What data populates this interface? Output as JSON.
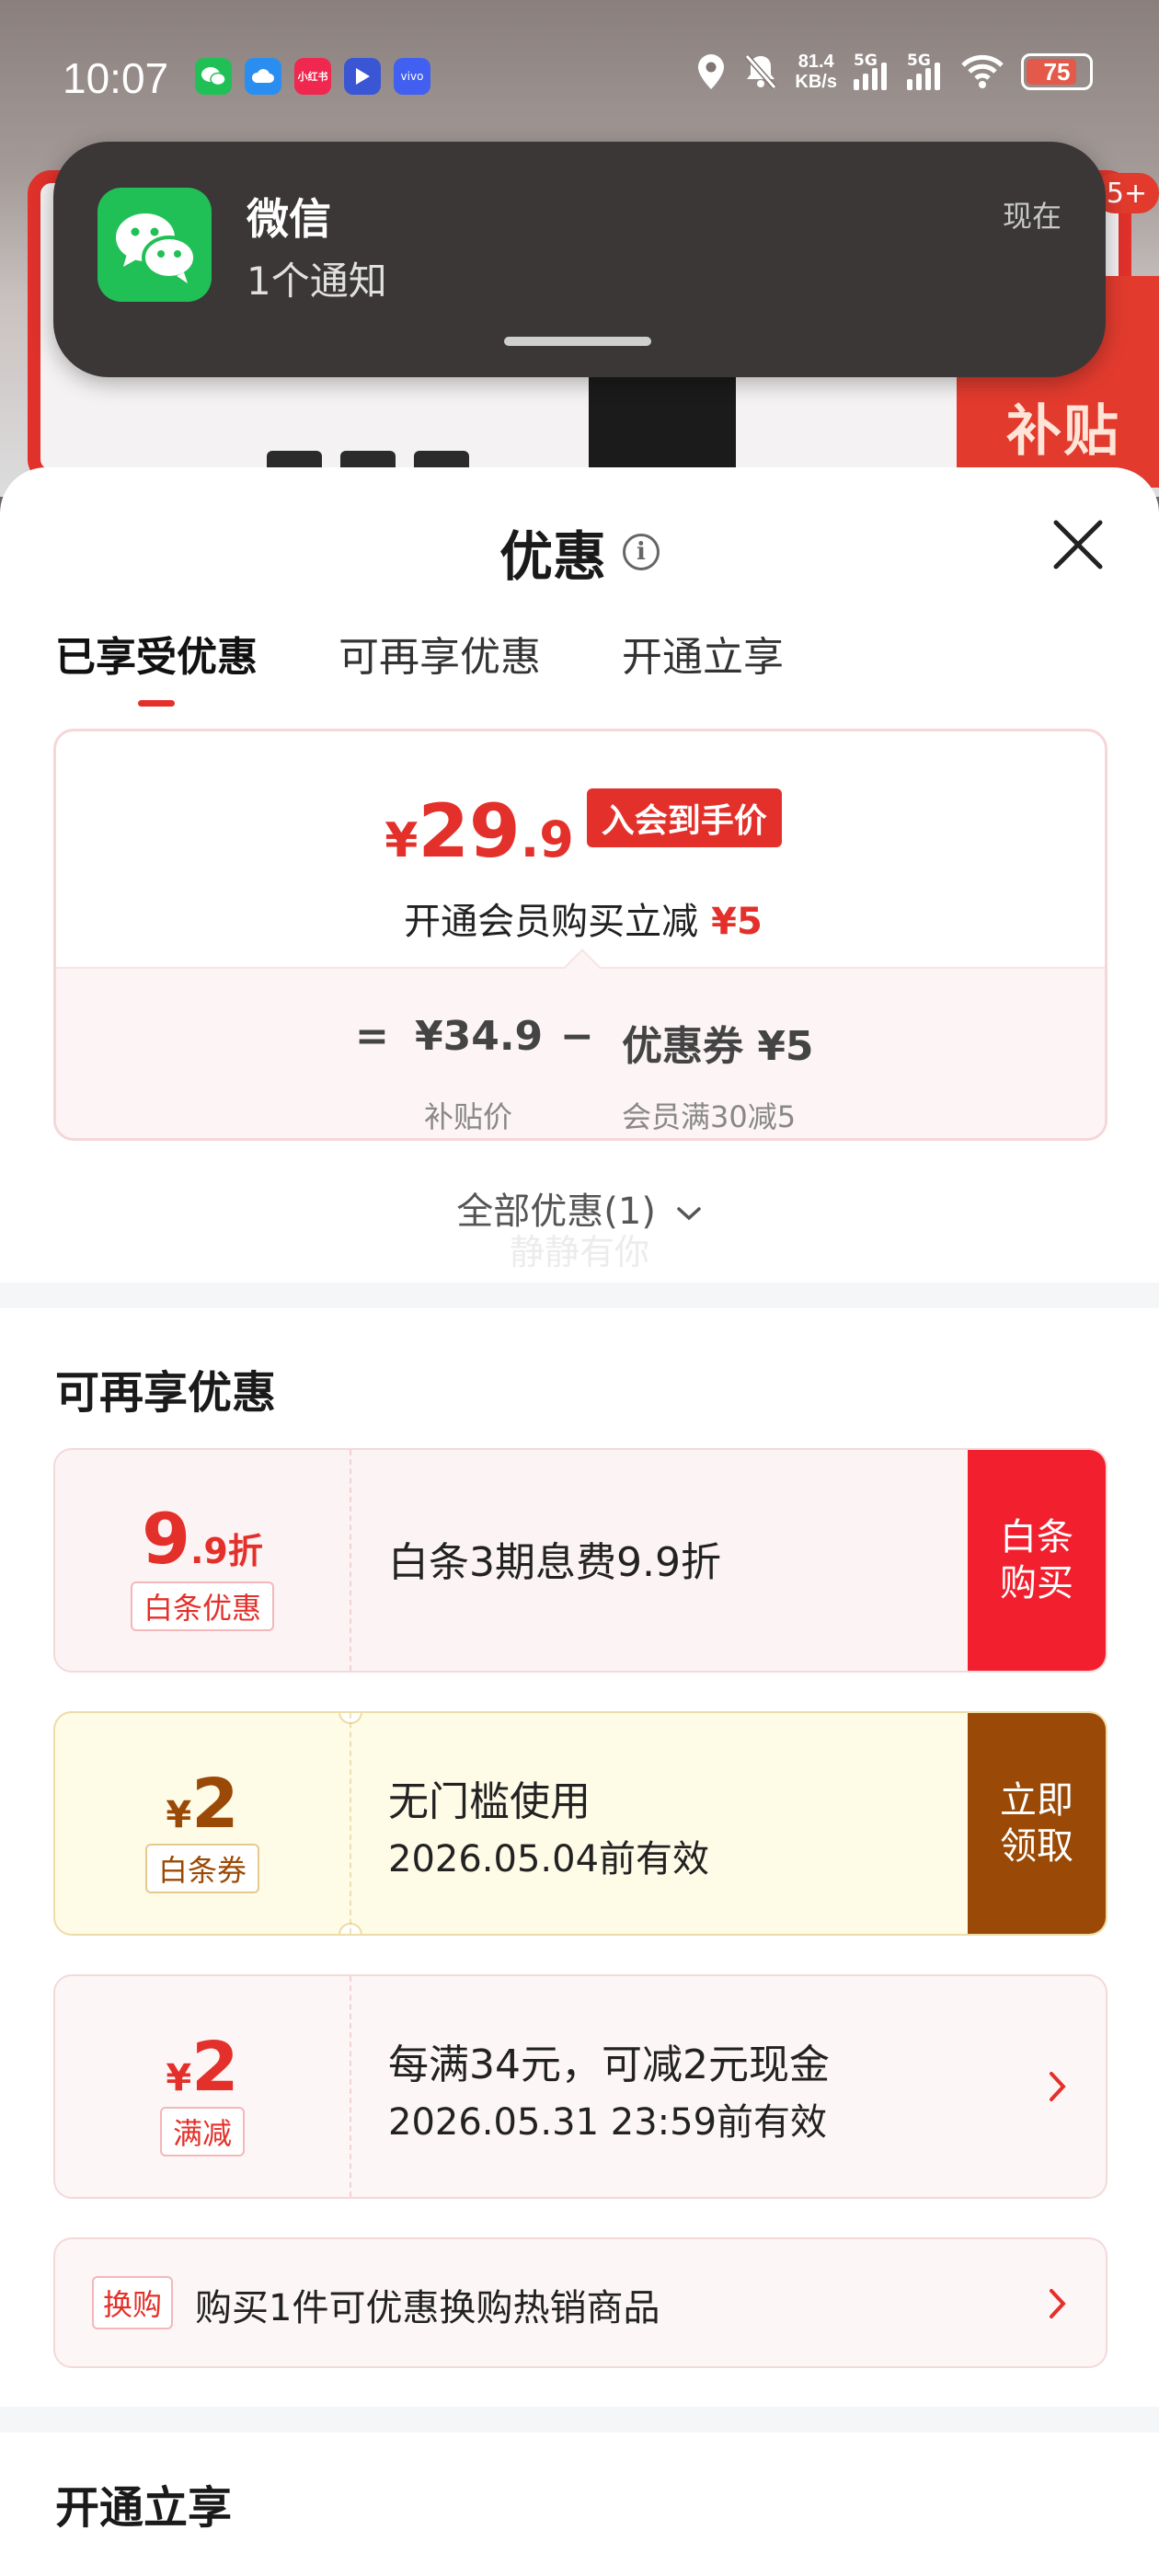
{
  "status_bar": {
    "time": "10:07",
    "app_icons": [
      {
        "name": "wechat-app-icon",
        "label": "",
        "color": "#21c056"
      },
      {
        "name": "cloud-app-icon",
        "label": "",
        "color": "#2a8ef0"
      },
      {
        "name": "xiaohongshu-app-icon",
        "label": "小红书",
        "color": "#f0274e"
      },
      {
        "name": "video-app-icon",
        "label": "",
        "color": "#3a56d4"
      },
      {
        "name": "vivo-app-icon",
        "label": "vivo",
        "color": "#415ff0"
      }
    ],
    "net_speed_value": "81.4",
    "net_speed_unit": "KB/s",
    "signal_1_label": "5G",
    "signal_2_label": "5G",
    "battery": "75"
  },
  "background": {
    "badge": "5+",
    "corner_text": "补贴"
  },
  "notification": {
    "app": "微信",
    "body": "1个通知",
    "time": "现在"
  },
  "sheet": {
    "title": "优惠",
    "tabs": [
      "已享受优惠",
      "可再享优惠",
      "开通立享"
    ],
    "active_tab": 0
  },
  "price_card": {
    "currency": "¥",
    "price_int": "29",
    "price_dec": ".9",
    "tag": "入会到手价",
    "sub_text": "开通会员购买立减",
    "sub_amount": "¥5",
    "equals": "=",
    "subsidy_price": "¥34.9",
    "minus": "−",
    "coupon_text": "优惠券 ¥5",
    "subsidy_label": "补贴价",
    "coupon_label": "会员满30减5"
  },
  "all_offers": "全部优惠(1)",
  "watermark": "静静有你",
  "section_more": "可再享优惠",
  "coupons": [
    {
      "value_main": "9",
      "value_suffix": ".9折",
      "tag": "白条优惠",
      "line1": "白条3期息费9.9折",
      "action": "白条购买",
      "action_color": "#f2202f"
    },
    {
      "currency": "¥",
      "value_main": "2",
      "tag": "白条券",
      "line1": "无门槛使用",
      "line2": "2026.05.04前有效",
      "action": "立即领取",
      "action_color": "#9a4a06"
    },
    {
      "currency": "¥",
      "value_main": "2",
      "tag": "满减",
      "line1": "每满34元，可减2元现金",
      "line2": "2026.05.31 23:59前有效"
    }
  ],
  "exchange": {
    "tag": "换购",
    "text": "购买1件可优惠换购热销商品"
  },
  "section_open": "开通立享",
  "colors": {
    "accent_red": "#e4302a",
    "gold_brown": "#9a4a06"
  }
}
